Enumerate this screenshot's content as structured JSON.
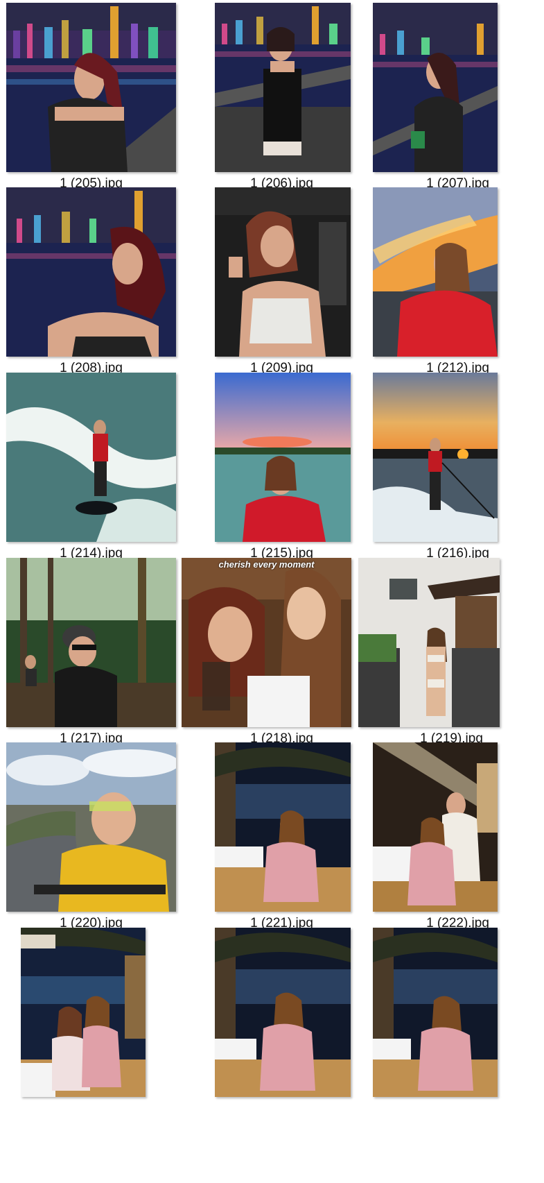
{
  "files": [
    {
      "name": "1 (205).jpg",
      "scene": "night-city"
    },
    {
      "name": "1 (206).jpg",
      "scene": "night-city"
    },
    {
      "name": "1 (207).jpg",
      "scene": "night-city"
    },
    {
      "name": "1 (208).jpg",
      "scene": "night-city"
    },
    {
      "name": "1 (209).jpg",
      "scene": "car-interior"
    },
    {
      "name": "1 (212).jpg",
      "scene": "sunset-boat"
    },
    {
      "name": "1 (214).jpg",
      "scene": "wakeboard-sea"
    },
    {
      "name": "1 (215).jpg",
      "scene": "lake-dusk"
    },
    {
      "name": "1 (216).jpg",
      "scene": "sunset-surf"
    },
    {
      "name": "1 (217).jpg",
      "scene": "forest-ride"
    },
    {
      "name": "1 (218).jpg",
      "scene": "cafe-selfie",
      "overlay_text": "cherish every moment"
    },
    {
      "name": "1 (219).jpg",
      "scene": "stone-house"
    },
    {
      "name": "1 (220).jpg",
      "scene": "kart-road"
    },
    {
      "name": "1 (221).jpg",
      "scene": "night-terrace"
    },
    {
      "name": "1 (222).jpg",
      "scene": "dinner-lights"
    },
    {
      "name": "",
      "scene": "terrace-duo"
    },
    {
      "name": "",
      "scene": "night-terrace"
    },
    {
      "name": "",
      "scene": "night-terrace"
    }
  ]
}
